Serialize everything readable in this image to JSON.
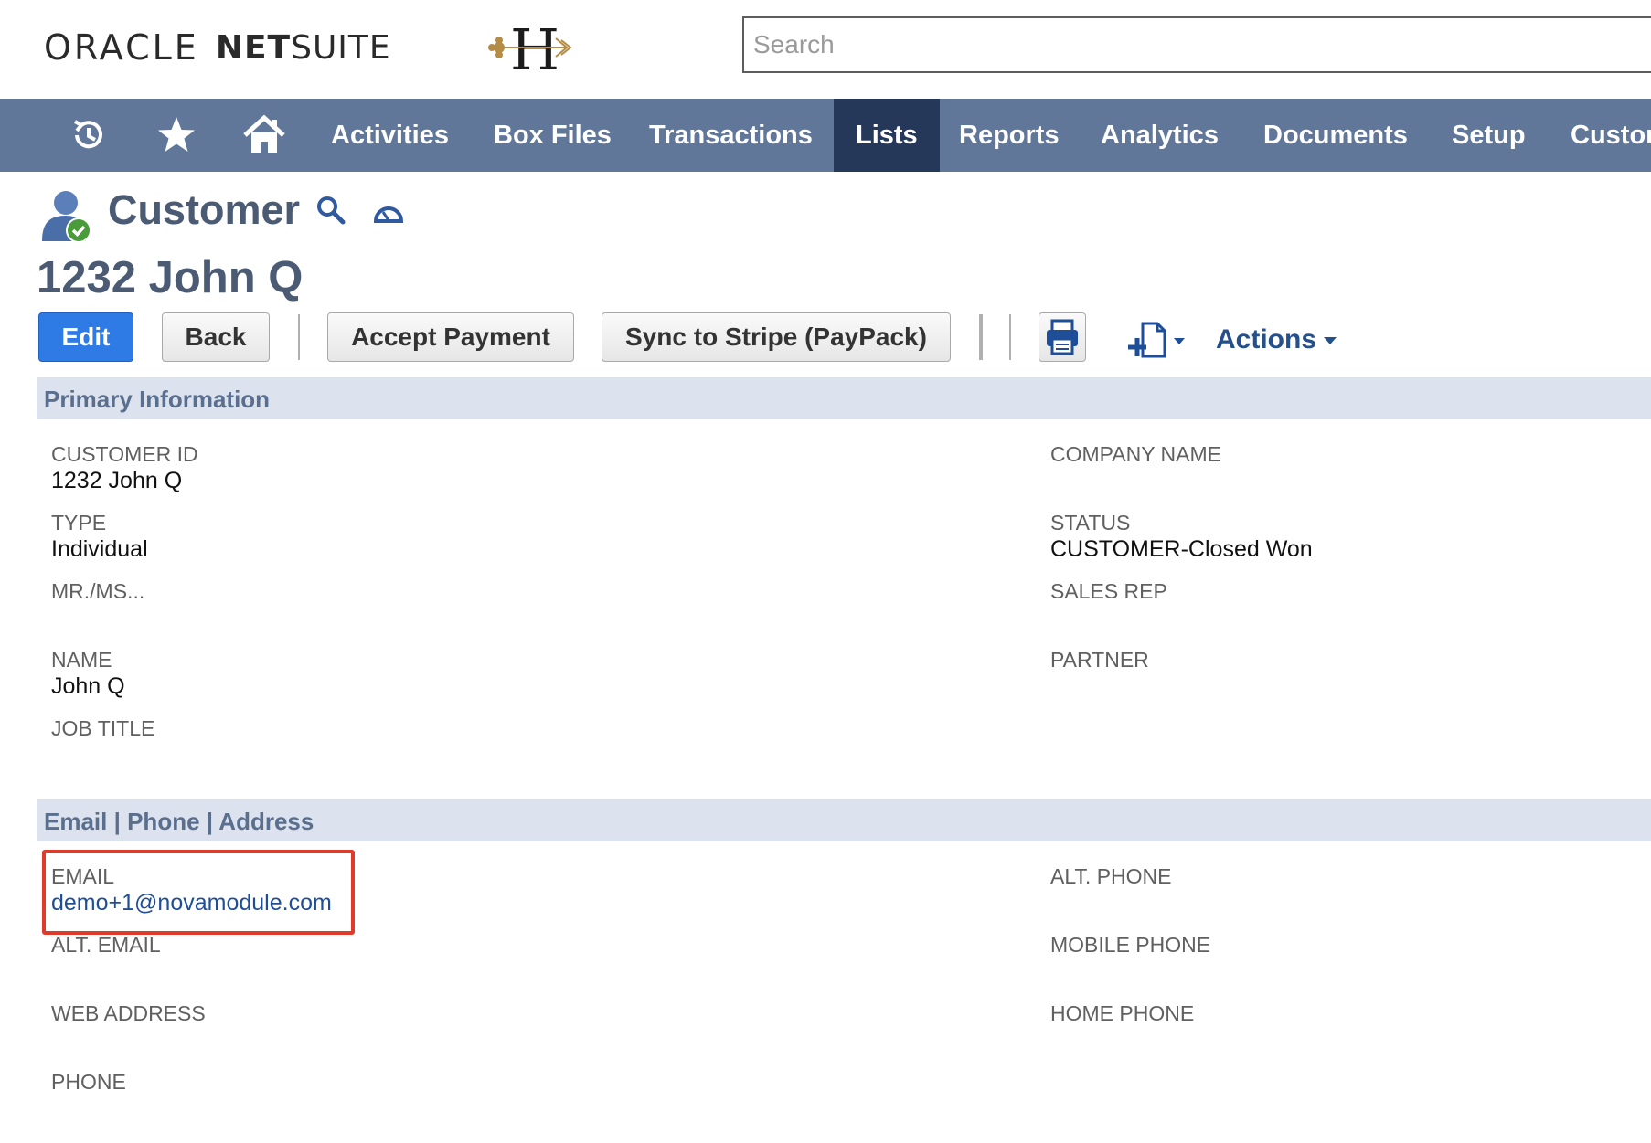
{
  "header": {
    "brand_oracle": "ORACLE",
    "brand_netsuite_bold": "NET",
    "brand_netsuite_rest": "SUITE",
    "search_placeholder": "Search",
    "company_logo": "H"
  },
  "nav": {
    "icons": [
      "recent-records-icon",
      "star-icon",
      "home-icon"
    ],
    "items": [
      {
        "label": "Activities"
      },
      {
        "label": "Box Files"
      },
      {
        "label": "Transactions"
      },
      {
        "label": "Lists",
        "active": true
      },
      {
        "label": "Reports"
      },
      {
        "label": "Analytics"
      },
      {
        "label": "Documents"
      },
      {
        "label": "Setup"
      },
      {
        "label": "Custom"
      }
    ]
  },
  "record": {
    "type": "Customer",
    "name": "1232 John Q"
  },
  "toolbar": {
    "edit": "Edit",
    "back": "Back",
    "accept_payment": "Accept Payment",
    "sync_stripe": "Sync to Stripe (PayPack)",
    "actions": "Actions"
  },
  "primary": {
    "title": "Primary Information",
    "customer_id_label": "CUSTOMER ID",
    "customer_id_value": "1232 John Q",
    "type_label": "TYPE",
    "type_value": "Individual",
    "mrms_label": "MR./MS...",
    "name_label": "NAME",
    "name_value": "John Q",
    "job_title_label": "JOB TITLE",
    "company_name_label": "COMPANY NAME",
    "status_label": "STATUS",
    "status_value": "CUSTOMER-Closed Won",
    "sales_rep_label": "SALES REP",
    "partner_label": "PARTNER"
  },
  "contact": {
    "title": "Email | Phone | Address",
    "email_label": "EMAIL",
    "email_value": "demo+1@novamodule.com",
    "alt_email_label": "ALT. EMAIL",
    "web_address_label": "WEB ADDRESS",
    "phone_label": "PHONE",
    "alt_phone_label": "ALT. PHONE",
    "mobile_phone_label": "MOBILE PHONE",
    "home_phone_label": "HOME PHONE"
  },
  "colors": {
    "nav_bg": "#607799",
    "nav_active": "#26385a",
    "primary_button": "#2f7be6",
    "section_bar": "#dde3ee",
    "link": "#1f4e99",
    "highlight": "#e03a2a"
  }
}
